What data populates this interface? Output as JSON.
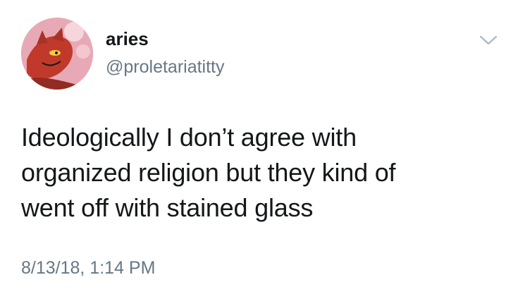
{
  "tweet": {
    "author": {
      "display_name": "aries",
      "handle": "@proletariatitty",
      "avatar_icon": "avatar-icon"
    },
    "menu_icon": "chevron-down-icon",
    "text_lines": [
      "Ideologically I don’t agree with",
      "organized religion but they kind of",
      "went off with stained glass"
    ],
    "timestamp": "8/13/18, 1:14 PM"
  },
  "colors": {
    "text_primary": "#14171a",
    "text_secondary": "#657786",
    "avatar_background": "#e8a9b6",
    "avatar_figure": "#c0392b"
  }
}
